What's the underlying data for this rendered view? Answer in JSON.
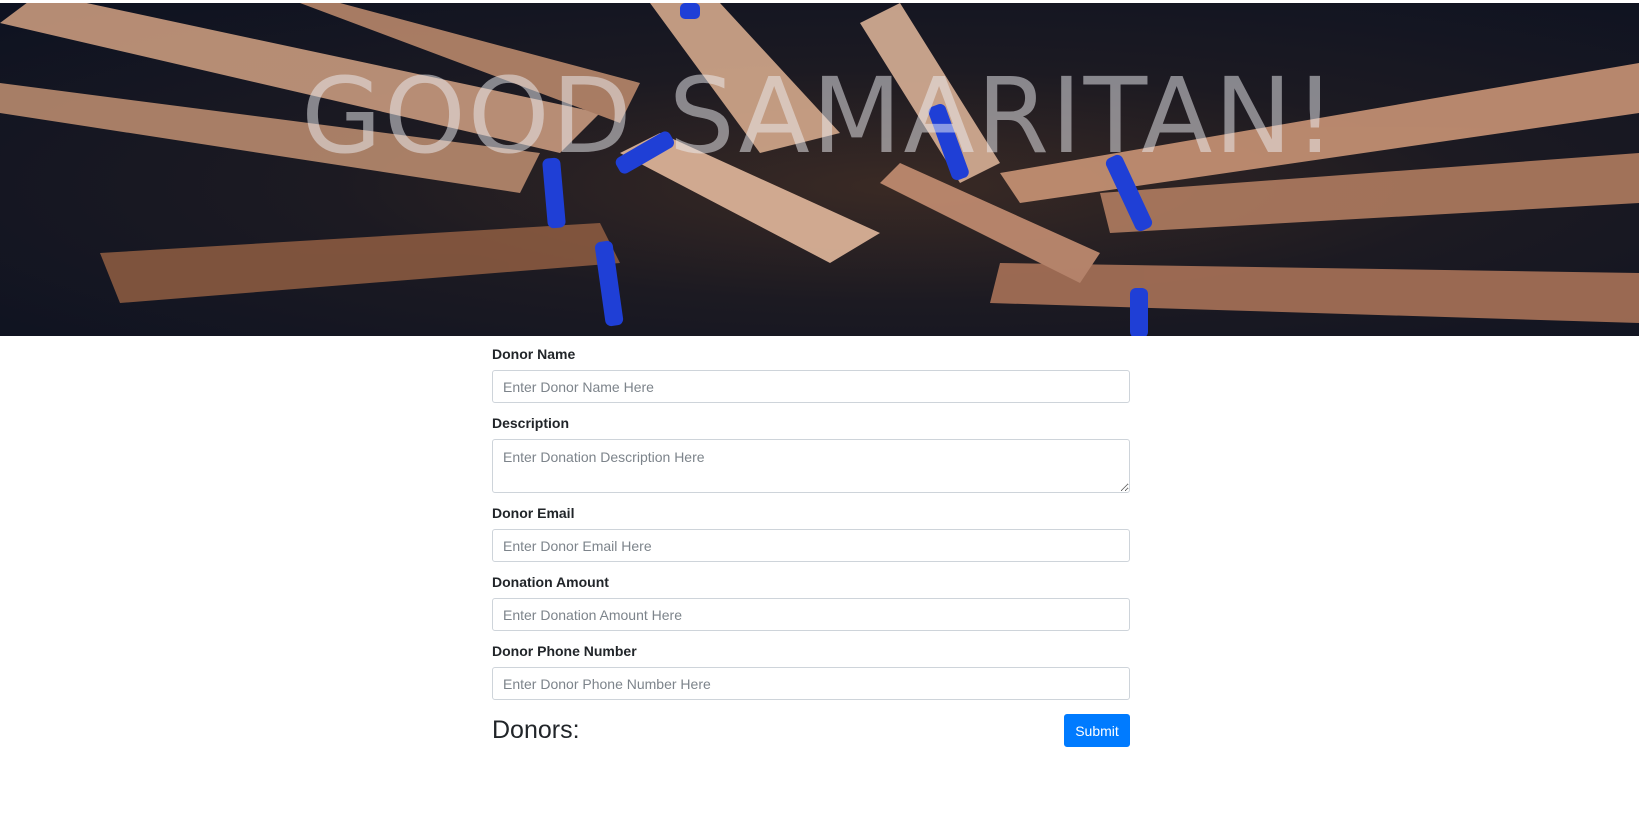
{
  "hero": {
    "title": "GOOD SAMARITAN!",
    "image": "hands-stacked-together-photo"
  },
  "form": {
    "fields": [
      {
        "label": "Donor Name",
        "placeholder": "Enter Donor Name Here",
        "value": ""
      },
      {
        "label": "Description",
        "placeholder": "Enter Donation Description Here",
        "value": ""
      },
      {
        "label": "Donor Email",
        "placeholder": "Enter Donor Email Here",
        "value": ""
      },
      {
        "label": "Donation Amount",
        "placeholder": "Enter Donation Amount Here",
        "value": ""
      },
      {
        "label": "Donor Phone Number",
        "placeholder": "Enter Donor Phone Number Here",
        "value": ""
      }
    ],
    "submit_label": "Submit"
  },
  "donors": {
    "heading": "Donors:"
  },
  "colors": {
    "primary": "#007bff",
    "text": "#212529",
    "border": "#ced4da",
    "wristband": "#1f3fd6"
  }
}
